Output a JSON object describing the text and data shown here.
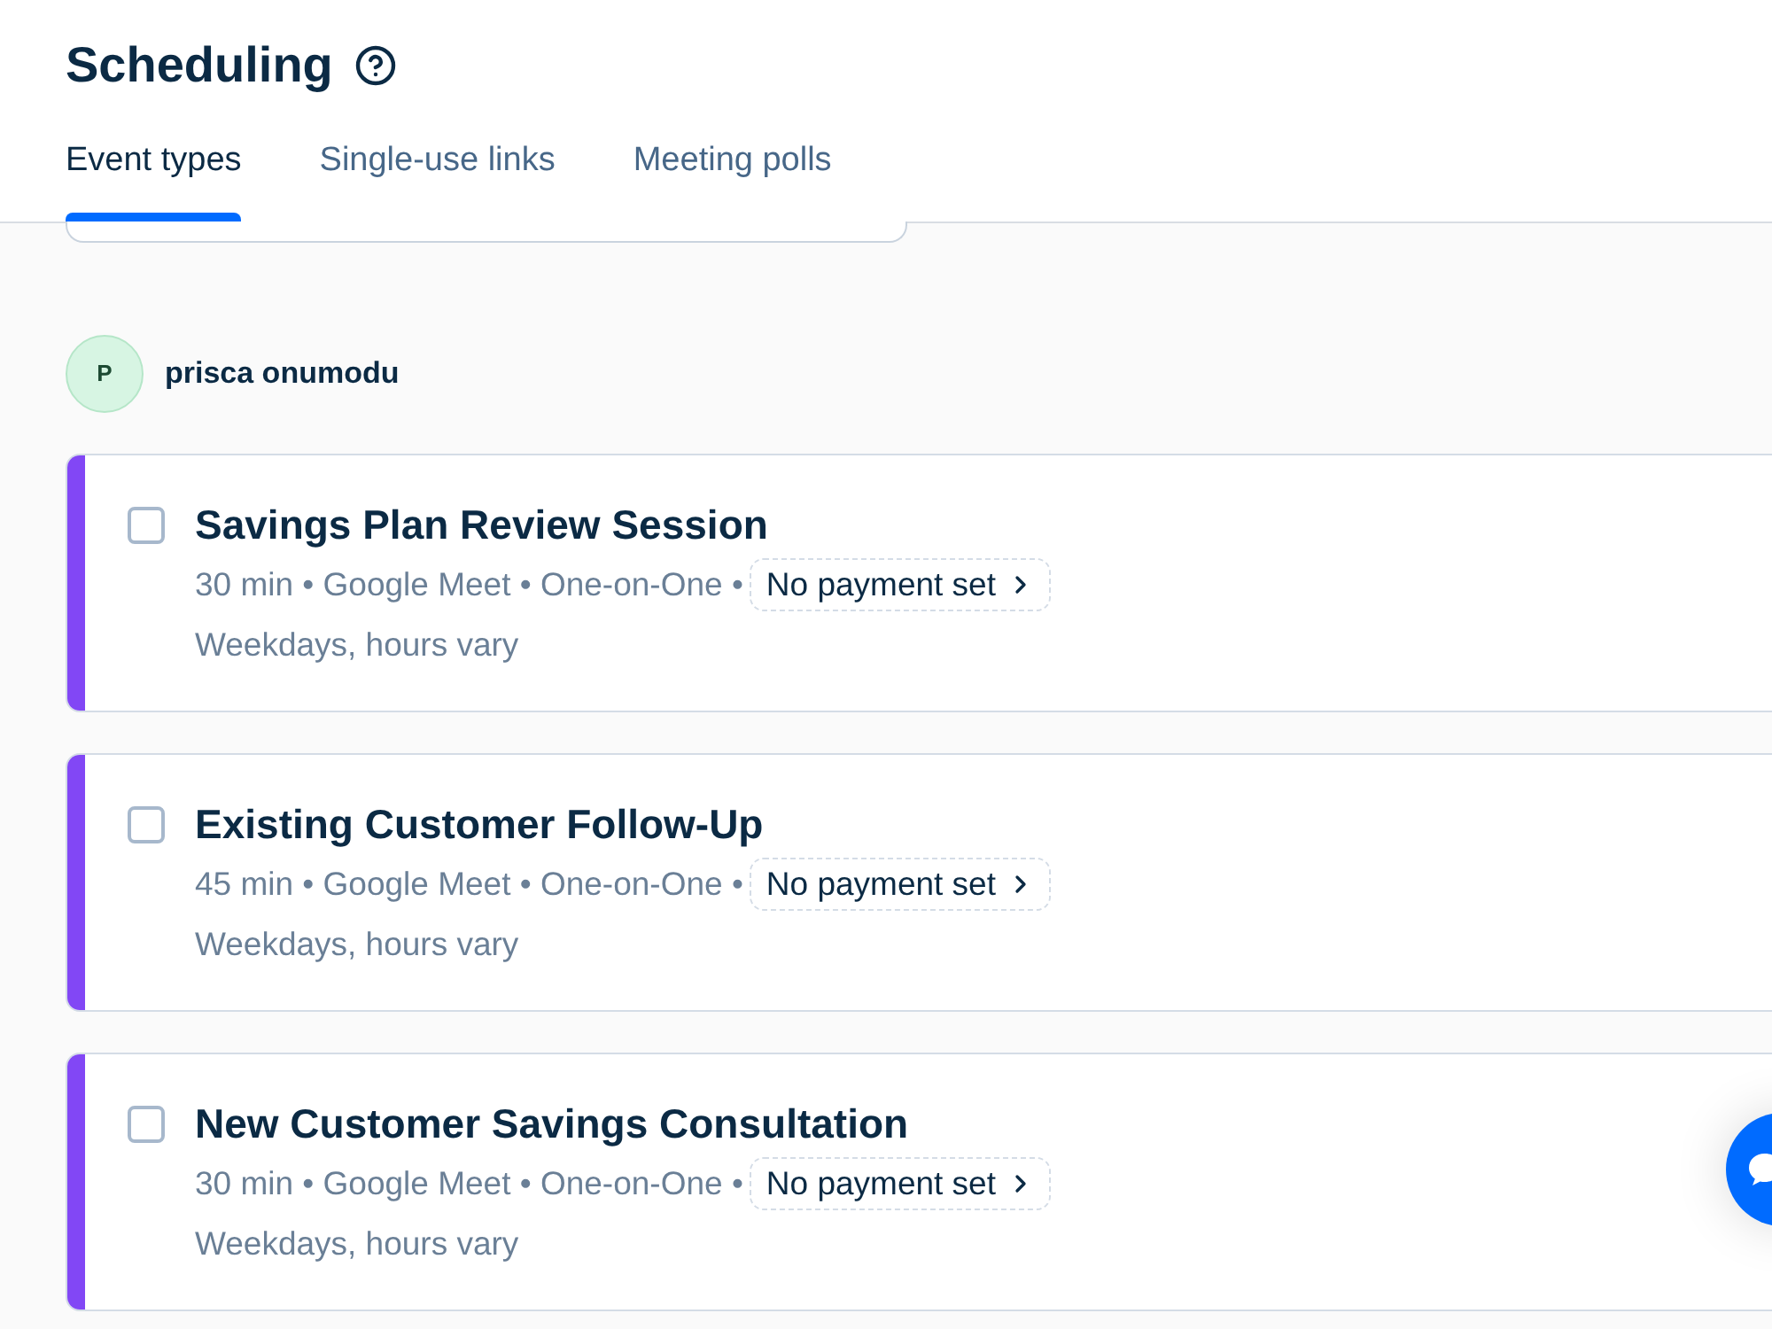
{
  "header": {
    "title": "Scheduling",
    "tabs": [
      {
        "label": "Event types",
        "selected": true
      },
      {
        "label": "Single-use links",
        "selected": false
      },
      {
        "label": "Meeting polls",
        "selected": false
      }
    ]
  },
  "owner": {
    "initial": "P",
    "name": "prisca onumodu"
  },
  "event_types": [
    {
      "checked": false,
      "color": "#8247f5",
      "title": "Savings Plan Review Session",
      "details": "30 min • Google Meet • One-on-One •",
      "payment": "No payment set",
      "availability": "Weekdays, hours vary"
    },
    {
      "checked": false,
      "color": "#8247f5",
      "title": "Existing Customer Follow-Up",
      "details": "45 min • Google Meet • One-on-One •",
      "payment": "No payment set",
      "availability": "Weekdays, hours vary"
    },
    {
      "checked": false,
      "color": "#8247f5",
      "title": "New Customer Savings Consultation",
      "details": "30 min • Google Meet • One-on-One •",
      "payment": "No payment set",
      "availability": "Weekdays, hours vary"
    }
  ]
}
